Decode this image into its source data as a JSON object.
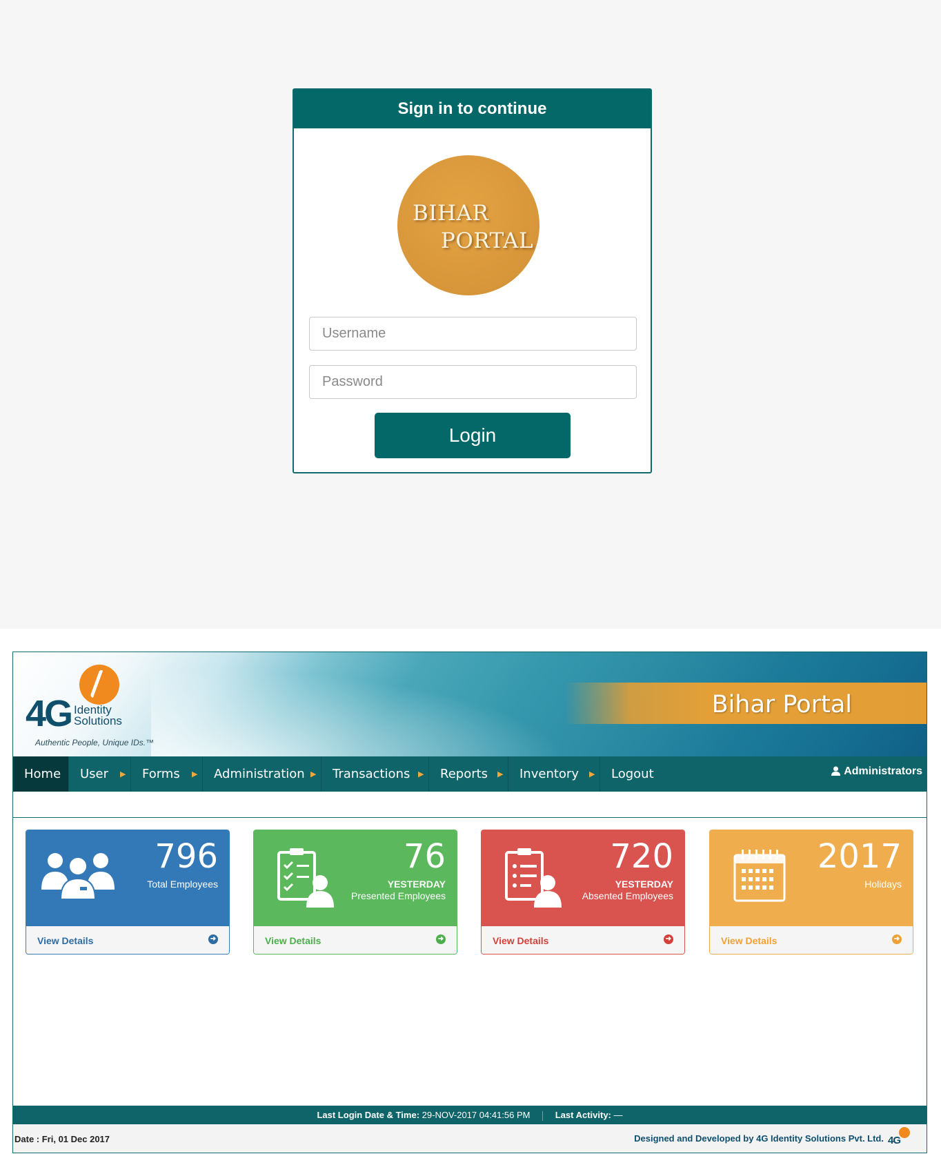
{
  "login": {
    "header": "Sign in to continue",
    "logo_line1": "BIHAR",
    "logo_line2": "PORTAL",
    "username_placeholder": "Username",
    "password_placeholder": "Password",
    "login_label": "Login"
  },
  "banner": {
    "company_logo_text": "4G",
    "company_logo_identity": "Identity",
    "company_logo_solutions": "Solutions",
    "tagline": "Authentic People, Unique IDs.™",
    "portal_title": "Bihar Portal"
  },
  "nav": {
    "items": [
      {
        "label": "Home",
        "has_submenu": false
      },
      {
        "label": "User",
        "has_submenu": true
      },
      {
        "label": "Forms",
        "has_submenu": true
      },
      {
        "label": "Administration",
        "has_submenu": true
      },
      {
        "label": "Transactions",
        "has_submenu": true
      },
      {
        "label": "Reports",
        "has_submenu": true
      },
      {
        "label": "Inventory",
        "has_submenu": true
      },
      {
        "label": "Logout",
        "has_submenu": false
      }
    ],
    "user_label": "Administrators"
  },
  "cards": [
    {
      "value": "796",
      "subtitle": "",
      "label": "Total Employees",
      "link": "View Details",
      "color": "#3479b7",
      "icon": "employees-icon"
    },
    {
      "value": "76",
      "subtitle": "YESTERDAY",
      "label": "Presented Employees",
      "link": "View Details",
      "color": "#5cb85c",
      "icon": "clipboard-check-icon"
    },
    {
      "value": "720",
      "subtitle": "YESTERDAY",
      "label": "Absented Employees",
      "link": "View Details",
      "color": "#d9534f",
      "icon": "clipboard-list-icon"
    },
    {
      "value": "2017",
      "subtitle": "",
      "label": "Holidays",
      "link": "View Details",
      "color": "#f0ad4e",
      "icon": "calendar-icon"
    }
  ],
  "footer": {
    "last_login_label": "Last Login Date & Time:",
    "last_login_value": "29-NOV-2017 04:41:56 PM",
    "last_activity_label": "Last Activity:",
    "last_activity_value": "—",
    "date_text": "Date : Fri, 01 Dec 2017",
    "credit_text": "Designed and Developed by 4G Identity Solutions Pvt. Ltd.",
    "footer_logo_text": "4G"
  },
  "colors": {
    "primary_teal": "#036867",
    "nav_active": "#06393b",
    "accent_orange": "#e39d35"
  }
}
